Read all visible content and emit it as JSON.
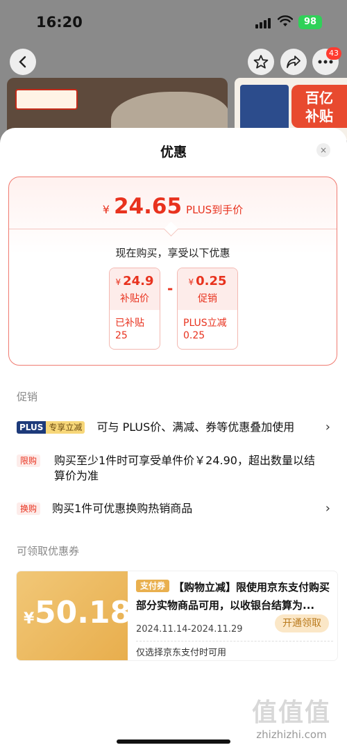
{
  "status_bar": {
    "time": "16:20",
    "battery": "98"
  },
  "nav": {
    "badge_count": "43"
  },
  "banner": {
    "right_tag": "百亿\n补贴"
  },
  "sheet": {
    "title": "优惠",
    "close_icon": "×",
    "price_card": {
      "currency": "¥",
      "final_price": "24.65",
      "final_label": "PLUS到手价",
      "subtitle": "现在购买，享受以下优惠",
      "minus_sign": "-",
      "items": [
        {
          "currency": "¥",
          "value": "24.9",
          "label": "补贴价",
          "detail_line1": "已补贴",
          "detail_line2": "25"
        },
        {
          "currency": "¥",
          "value": "0.25",
          "label": "促销",
          "detail_line1": "PLUS立减",
          "detail_line2": "0.25"
        }
      ]
    },
    "promotions": {
      "heading": "促销",
      "rows": [
        {
          "tag_a": "PLUS",
          "tag_b": "专享立减",
          "text": "可与 PLUS价、满减、券等优惠叠加使用",
          "chevron": "›"
        },
        {
          "tag": "限购",
          "text": "购买至少1件时可享受单件价￥24.90，超出数量以结算价为准"
        },
        {
          "tag": "换购",
          "text": "购买1件可优惠换购热销商品",
          "chevron": "›"
        }
      ]
    },
    "coupons": {
      "heading": "可领取优惠券",
      "items": [
        {
          "currency": "¥",
          "value": "50.18",
          "tag": "支付券",
          "title": "【购物立减】限使用京东支付购买部分实物商品可用，以收银台结算为...",
          "date": "2024.11.14-2024.11.29",
          "button": "开通领取",
          "note": "仅选择京东支付时可用"
        }
      ]
    }
  },
  "watermark": {
    "mark": "值值值",
    "url": "zhizhizhi.com"
  },
  "colors": {
    "accent_red": "#e8321e",
    "coupon_gold": "#e8ae4d",
    "plus_blue": "#1d3a7a"
  }
}
